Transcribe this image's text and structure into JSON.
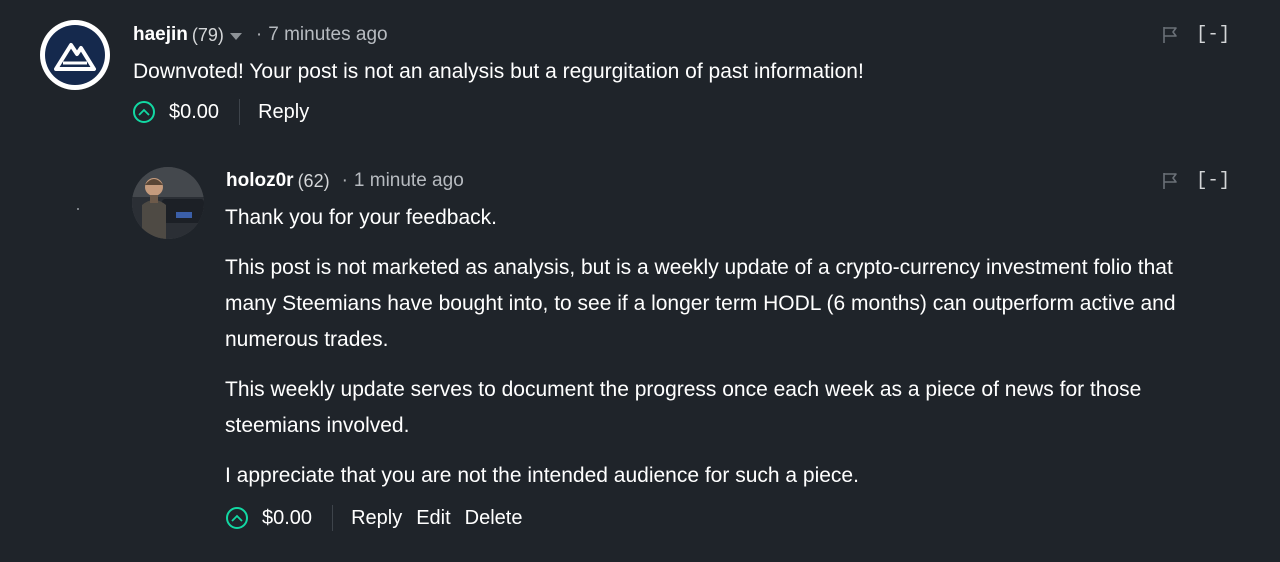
{
  "colors": {
    "background": "#1f242a",
    "upvote_accent": "#12d8a3",
    "muted_text": "#b7bbc0"
  },
  "comments": [
    {
      "author": "haejin",
      "reputation": "(79)",
      "separator": "·",
      "time": "7 minutes ago",
      "avatar_icon": "mountain-logo-icon",
      "body": "Downvoted! Your post is not an analysis but a regurgitation of past information!",
      "payout": "$0.00",
      "actions": [
        "Reply"
      ],
      "collapse": "[-]"
    },
    {
      "author": "holoz0r",
      "reputation": "(62)",
      "separator": "·",
      "time": "1 minute ago",
      "avatar_icon": "user-photo-avatar",
      "paragraphs": [
        "Thank you for your feedback.",
        "This post is not marketed as analysis, but is a weekly update of a crypto-currency investment folio that many Steemians have bought into, to see if a longer term HODL (6 months) can outperform active and numerous trades.",
        "This weekly update serves to document the progress once each week as a piece of news for those steemians involved.",
        "I appreciate that you are not the intended audience for such a piece."
      ],
      "payout": "$0.00",
      "actions": [
        "Reply",
        "Edit",
        "Delete"
      ],
      "collapse": "[-]"
    }
  ]
}
